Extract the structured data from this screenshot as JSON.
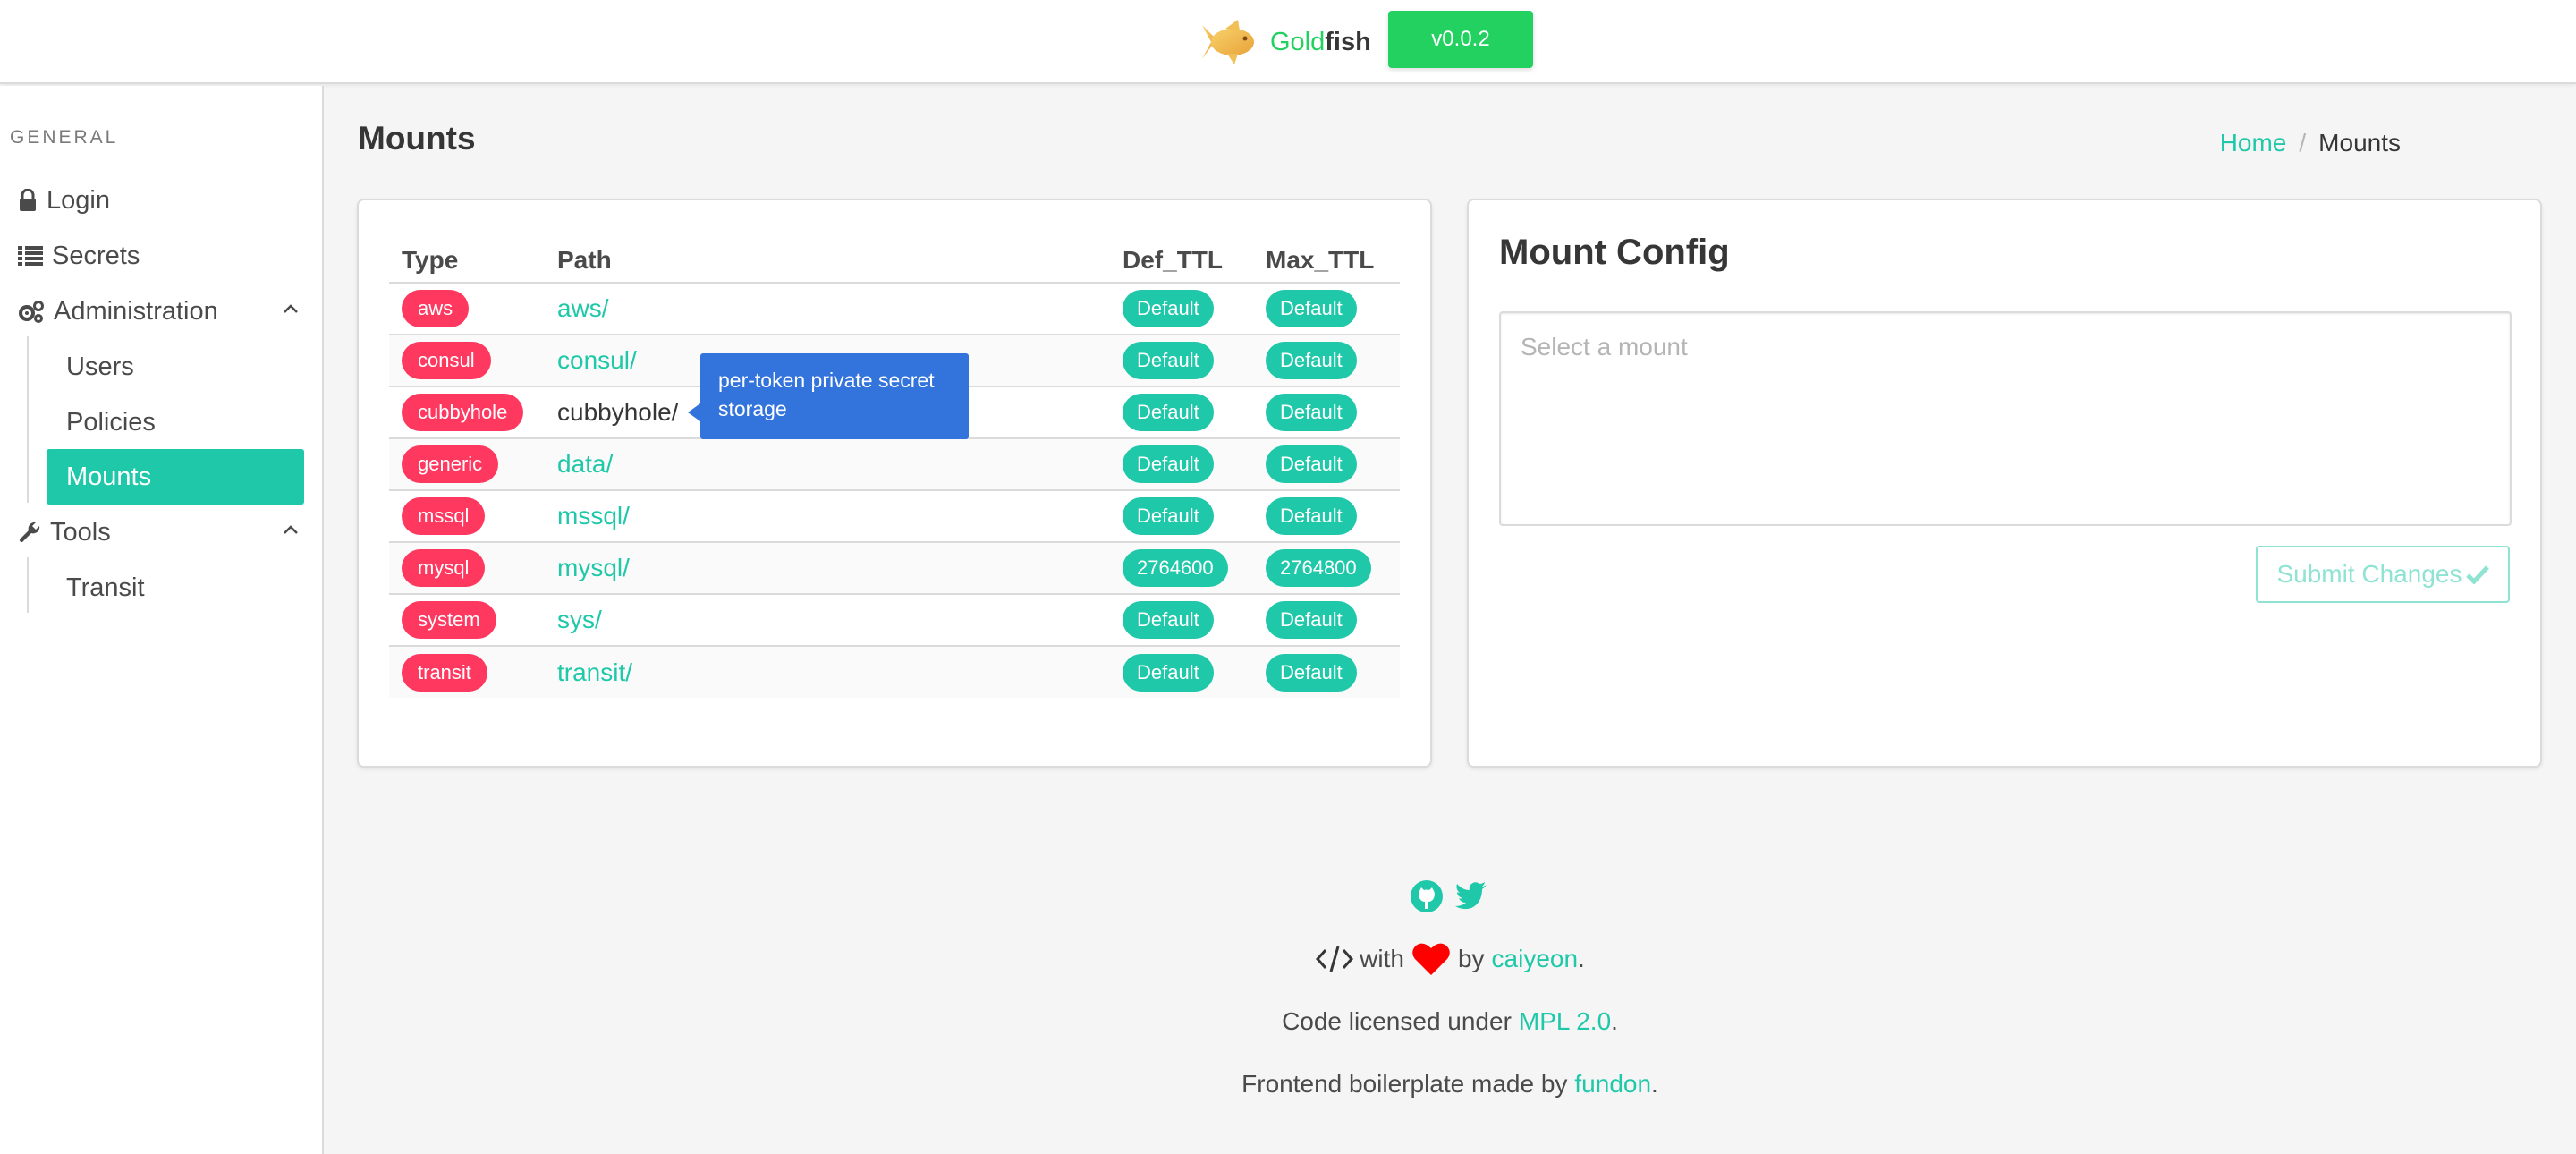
{
  "header": {
    "brand_gold": "Gold",
    "brand_fish": "fish",
    "version": "v0.0.2",
    "icon": "goldfish-logo"
  },
  "sidebar": {
    "section_label": "GENERAL",
    "items": [
      {
        "label": "Login",
        "icon": "lock-icon"
      },
      {
        "label": "Secrets",
        "icon": "list-icon"
      },
      {
        "label": "Administration",
        "icon": "gears-icon",
        "expanded": true,
        "children": [
          "Users",
          "Policies",
          "Mounts"
        ]
      },
      {
        "label": "Tools",
        "icon": "wrench-icon",
        "expanded": true,
        "children": [
          "Transit"
        ]
      }
    ],
    "active": "Mounts"
  },
  "page": {
    "title": "Mounts",
    "breadcrumb": {
      "home": "Home",
      "separator": "/",
      "current": "Mounts"
    }
  },
  "mounts_table": {
    "headers": [
      "Type",
      "Path",
      "Def_TTL",
      "Max_TTL"
    ],
    "rows": [
      {
        "type": "aws",
        "path": "aws/",
        "def_ttl": "Default",
        "max_ttl": "Default"
      },
      {
        "type": "consul",
        "path": "consul/",
        "def_ttl": "Default",
        "max_ttl": "Default"
      },
      {
        "type": "cubbyhole",
        "path": "cubbyhole/",
        "def_ttl": "Default",
        "max_ttl": "Default"
      },
      {
        "type": "generic",
        "path": "data/",
        "def_ttl": "Default",
        "max_ttl": "Default"
      },
      {
        "type": "mssql",
        "path": "mssql/",
        "def_ttl": "Default",
        "max_ttl": "Default"
      },
      {
        "type": "mysql",
        "path": "mysql/",
        "def_ttl": "2764600",
        "max_ttl": "2764800"
      },
      {
        "type": "system",
        "path": "sys/",
        "def_ttl": "Default",
        "max_ttl": "Default"
      },
      {
        "type": "transit",
        "path": "transit/",
        "def_ttl": "Default",
        "max_ttl": "Default"
      }
    ],
    "tooltip": "per-token private secret storage"
  },
  "mount_config": {
    "title": "Mount Config",
    "placeholder": "Select a mount",
    "submit_label": "Submit Changes"
  },
  "footer": {
    "with": "with",
    "by": "by",
    "author": "caiyeon",
    "license_prefix": "Code licensed under",
    "license": "MPL 2.0",
    "boilerplate_prefix": "Frontend boilerplate made by",
    "boilerplate_author": "fundon",
    "period": "."
  },
  "colors": {
    "primary": "#1fc8a9",
    "success": "#23d160",
    "danger": "#ff3860",
    "info": "#3273dc"
  }
}
